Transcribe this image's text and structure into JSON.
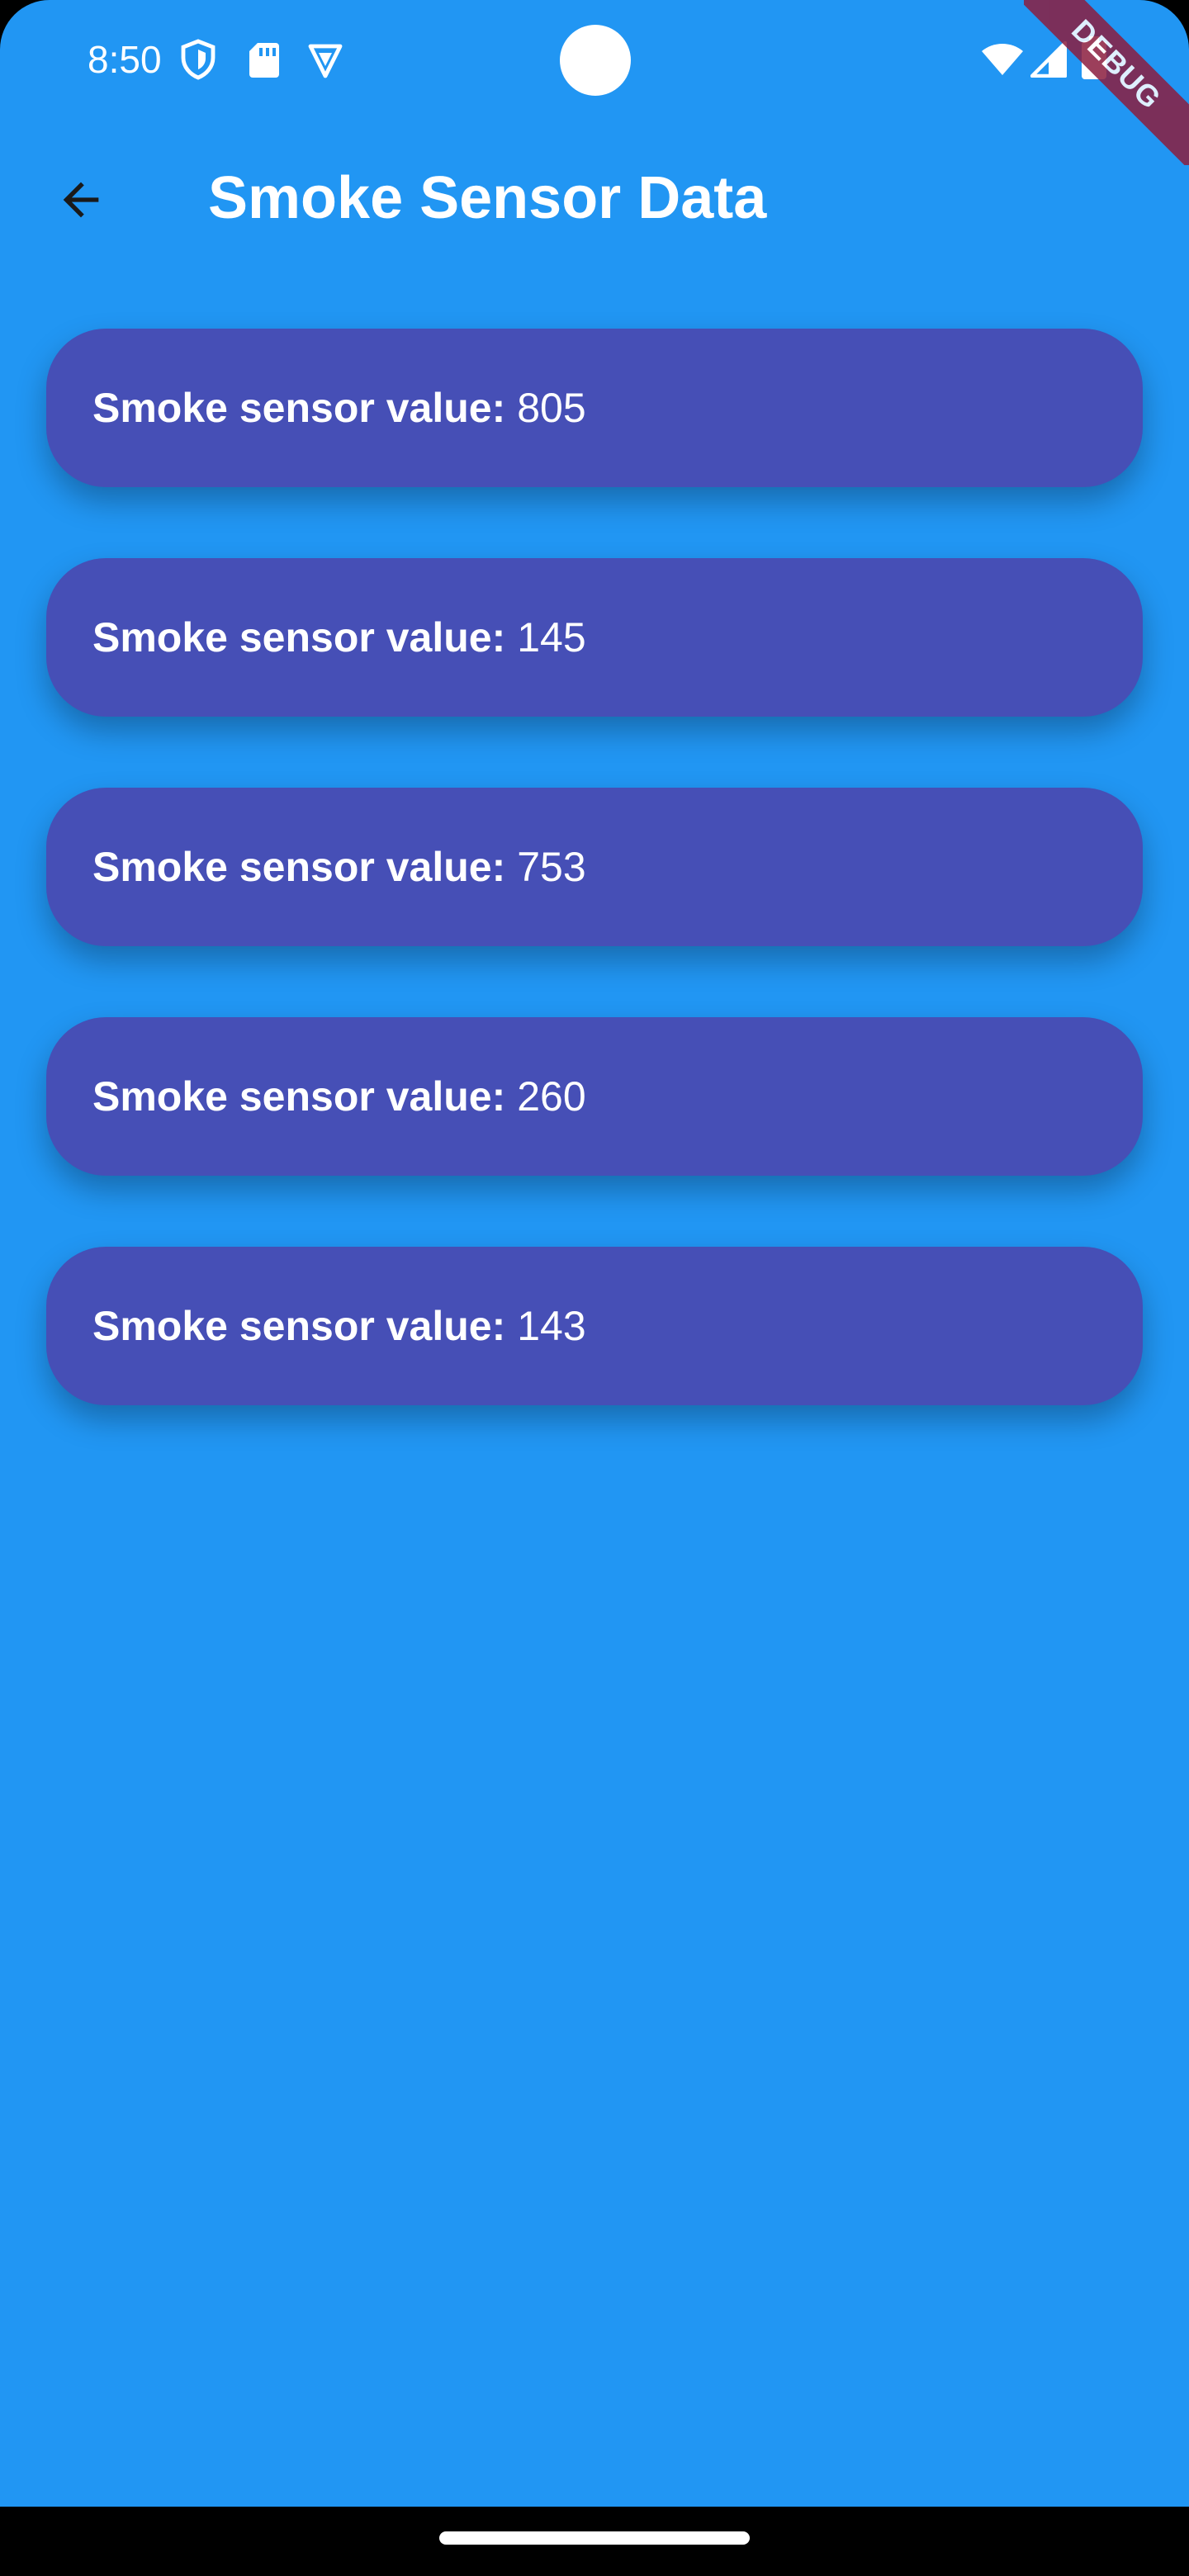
{
  "status_bar": {
    "time": "8:50",
    "left_icons": [
      "shield-icon",
      "sd-card-icon",
      "vpn-icon"
    ],
    "right_icons": [
      "wifi-icon",
      "cellular-signal-icon",
      "battery-icon"
    ]
  },
  "debug_banner": {
    "label": "DEBUG",
    "color": "#8b1e3f"
  },
  "app_bar": {
    "back_icon": "arrow-back-icon",
    "title": "Smoke Sensor Data"
  },
  "readings": [
    {
      "label": "Smoke sensor value:",
      "value": "805"
    },
    {
      "label": "Smoke sensor value:",
      "value": "145"
    },
    {
      "label": "Smoke sensor value:",
      "value": "753"
    },
    {
      "label": "Smoke sensor value:",
      "value": "260"
    },
    {
      "label": "Smoke sensor value:",
      "value": "143"
    }
  ],
  "colors": {
    "background": "#2196f3",
    "card": "#464fb6",
    "text": "#ffffff"
  }
}
